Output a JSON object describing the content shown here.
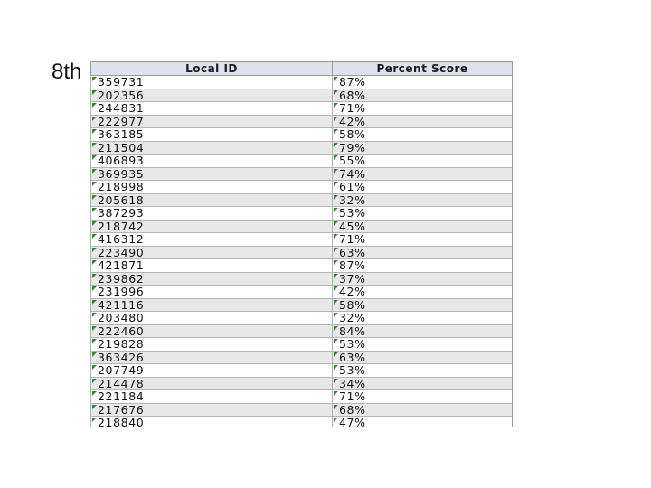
{
  "slide_label": "8th",
  "table": {
    "headers": [
      "Local ID",
      "Percent Score"
    ],
    "rows": [
      [
        "359731",
        "87%"
      ],
      [
        "202356",
        "68%"
      ],
      [
        "244831",
        "71%"
      ],
      [
        "222977",
        "42%"
      ],
      [
        "363185",
        "58%"
      ],
      [
        "211504",
        "79%"
      ],
      [
        "406893",
        "55%"
      ],
      [
        "369935",
        "74%"
      ],
      [
        "218998",
        "61%"
      ],
      [
        "205618",
        "32%"
      ],
      [
        "387293",
        "53%"
      ],
      [
        "218742",
        "45%"
      ],
      [
        "416312",
        "71%"
      ],
      [
        "223490",
        "63%"
      ],
      [
        "421871",
        "87%"
      ],
      [
        "239862",
        "37%"
      ],
      [
        "231996",
        "42%"
      ],
      [
        "421116",
        "58%"
      ],
      [
        "203480",
        "32%"
      ],
      [
        "222460",
        "84%"
      ],
      [
        "219828",
        "53%"
      ],
      [
        "363426",
        "63%"
      ],
      [
        "207749",
        "53%"
      ],
      [
        "214478",
        "34%"
      ],
      [
        "221184",
        "71%"
      ],
      [
        "217676",
        "68%"
      ],
      [
        "218840",
        "47%"
      ]
    ]
  }
}
